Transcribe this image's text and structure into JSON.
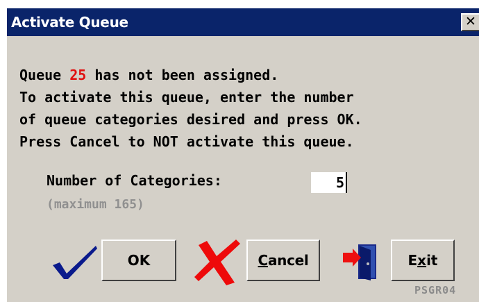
{
  "window": {
    "title": "Activate Queue",
    "close_glyph": "✕",
    "title_bg": "#0a246a",
    "face": "#d4d0c8"
  },
  "message": {
    "line1_prefix": "Queue ",
    "queue_number": "25",
    "line1_suffix": " has not been assigned.",
    "line2": "To activate this queue, enter the number",
    "line3": "of queue categories desired and press OK.",
    "line4": "Press Cancel to NOT activate this queue.",
    "queue_number_color": "#e01010"
  },
  "categories": {
    "label": "Number of Categories:",
    "value": "5",
    "max_note": "(maximum 165)"
  },
  "buttons": {
    "ok_label": "OK",
    "cancel_prefix": "",
    "cancel_mnemonic": "C",
    "cancel_suffix": "ancel",
    "exit_prefix": "E",
    "exit_mnemonic": "x",
    "exit_suffix": "it"
  },
  "icons": {
    "confirm": "checkmark-icon",
    "cancel": "red-x-icon",
    "exit": "exit-door-icon"
  },
  "footer": {
    "screen_code": "PSGR04"
  }
}
